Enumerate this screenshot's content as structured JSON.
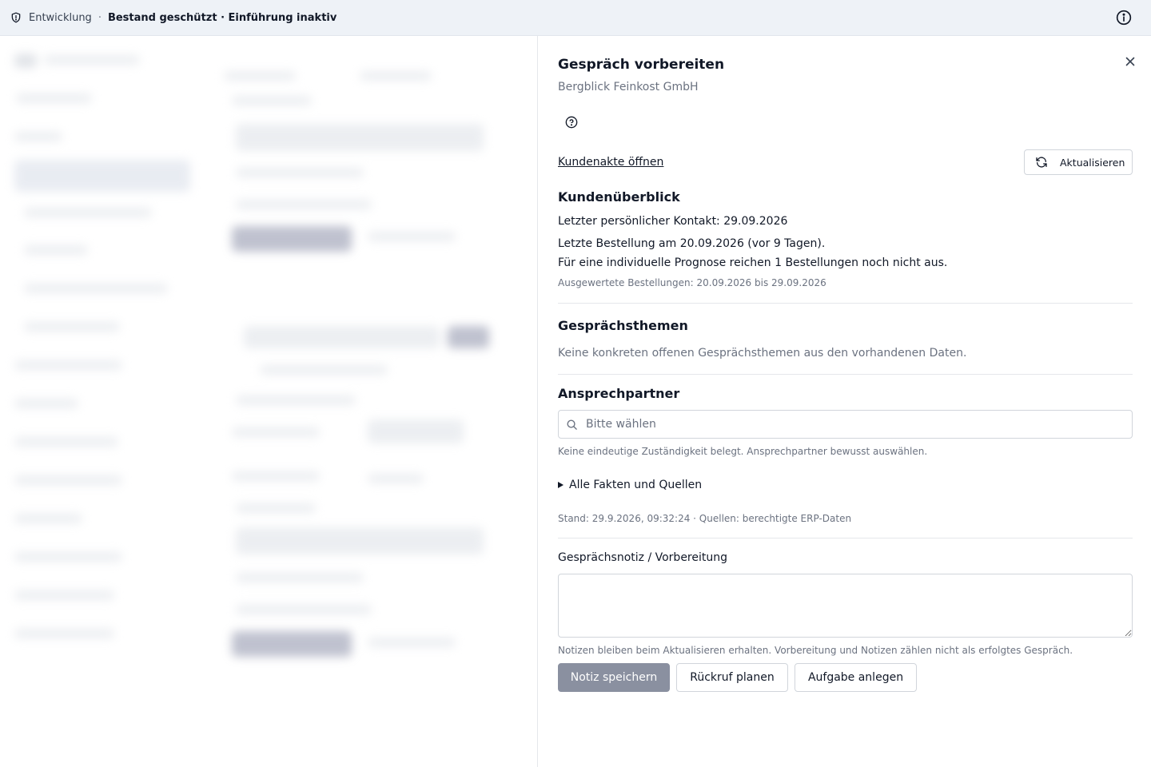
{
  "topbar": {
    "environment": "Entwicklung",
    "separator": "·",
    "status": "Bestand geschützt · Einführung inaktiv",
    "icons": {
      "left": "shield-icon",
      "right": "info-icon"
    }
  },
  "drawer": {
    "title": "Gespräch vorbereiten",
    "subtitle": "Bergblick Feinkost GmbH",
    "customer_file_link": "Kundenakte öffnen",
    "refresh_label": "Aktualisieren",
    "overview": {
      "heading": "Kundenüberblick",
      "last_contact": "Letzter persönlicher Kontakt: 29.09.2026",
      "last_order": "Letzte Bestellung am 20.09.2026 (vor 9 Tagen).",
      "forecast_note": "Für eine individuelle Prognose reichen 1 Bestellungen noch nicht aus.",
      "evaluated_orders": "Ausgewertete Bestellungen: 20.09.2026 bis 29.09.2026"
    },
    "topics": {
      "heading": "Gesprächsthemen",
      "empty_text": "Keine konkreten offenen Gesprächsthemen aus den vorhandenen Daten."
    },
    "contact": {
      "heading": "Ansprechpartner",
      "placeholder": "Bitte wählen",
      "value": "",
      "hint": "Keine eindeutige Zuständigkeit belegt. Ansprechpartner bewusst auswählen."
    },
    "facts_toggle": "Alle Fakten und Quellen",
    "source_line": "Stand: 29.9.2026, 09:32:24 · Quellen: berechtigte ERP-Daten",
    "note": {
      "label": "Gesprächsnotiz / Vorbereitung",
      "value": "",
      "hint": "Notizen bleiben beim Aktualisieren erhalten. Vorbereitung und Notizen zählen nicht als erfolgtes Gespräch."
    },
    "actions": {
      "save": "Notiz speichern",
      "callback": "Rückruf planen",
      "task": "Aufgabe anlegen"
    },
    "colors": {
      "primary_button_disabled": "#8a90a0",
      "topbar_bg": "#eef2f7"
    }
  }
}
